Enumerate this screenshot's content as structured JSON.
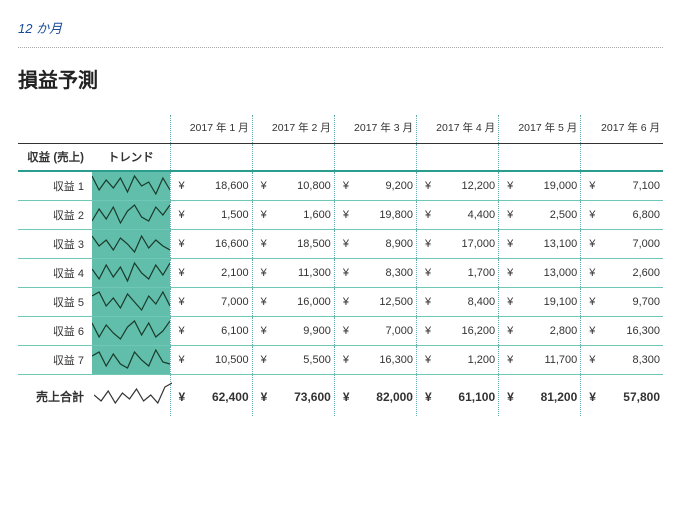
{
  "subtitle": "12 か月",
  "title": "損益予測",
  "columns": [
    "2017 年 1 月",
    "2017 年 2 月",
    "2017 年 3 月",
    "2017 年 4 月",
    "2017 年 5 月",
    "2017 年 6 月"
  ],
  "section_label": "収益 (売上)",
  "trend_label": "トレンド",
  "currency": "¥",
  "rows": [
    {
      "label": "収益 1",
      "values": [
        18600,
        10800,
        9200,
        12200,
        19000,
        7100
      ],
      "spark": [
        4,
        18,
        8,
        16,
        6,
        20,
        4,
        14,
        10,
        22,
        6,
        18
      ]
    },
    {
      "label": "収益 2",
      "values": [
        1500,
        1600,
        19800,
        4400,
        2500,
        6800
      ],
      "spark": [
        20,
        8,
        18,
        6,
        22,
        10,
        4,
        16,
        20,
        6,
        14,
        4
      ]
    },
    {
      "label": "収益 3",
      "values": [
        16600,
        18500,
        8900,
        17000,
        13100,
        7000
      ],
      "spark": [
        6,
        16,
        10,
        20,
        8,
        14,
        22,
        6,
        18,
        10,
        16,
        20
      ]
    },
    {
      "label": "収益 4",
      "values": [
        2100,
        11300,
        8300,
        1700,
        13000,
        2600
      ],
      "spark": [
        10,
        20,
        6,
        18,
        8,
        22,
        4,
        14,
        20,
        6,
        16,
        4
      ]
    },
    {
      "label": "収益 5",
      "values": [
        7000,
        16000,
        12500,
        8400,
        19100,
        9700
      ],
      "spark": [
        8,
        4,
        18,
        10,
        20,
        6,
        14,
        22,
        8,
        16,
        4,
        18
      ]
    },
    {
      "label": "収益 6",
      "values": [
        6100,
        9900,
        7000,
        16200,
        2800,
        16300
      ],
      "spark": [
        6,
        20,
        8,
        16,
        22,
        10,
        4,
        18,
        6,
        20,
        14,
        4
      ]
    },
    {
      "label": "収益 7",
      "values": [
        10500,
        5500,
        16300,
        1200,
        11700,
        8300
      ],
      "spark": [
        10,
        6,
        20,
        8,
        18,
        22,
        6,
        14,
        20,
        4,
        16,
        18
      ]
    }
  ],
  "total": {
    "label": "売上合計",
    "values": [
      62400,
      73600,
      82000,
      61100,
      81200,
      57800
    ],
    "spark": [
      14,
      20,
      10,
      22,
      12,
      18,
      8,
      20,
      14,
      22,
      6,
      2
    ]
  }
}
